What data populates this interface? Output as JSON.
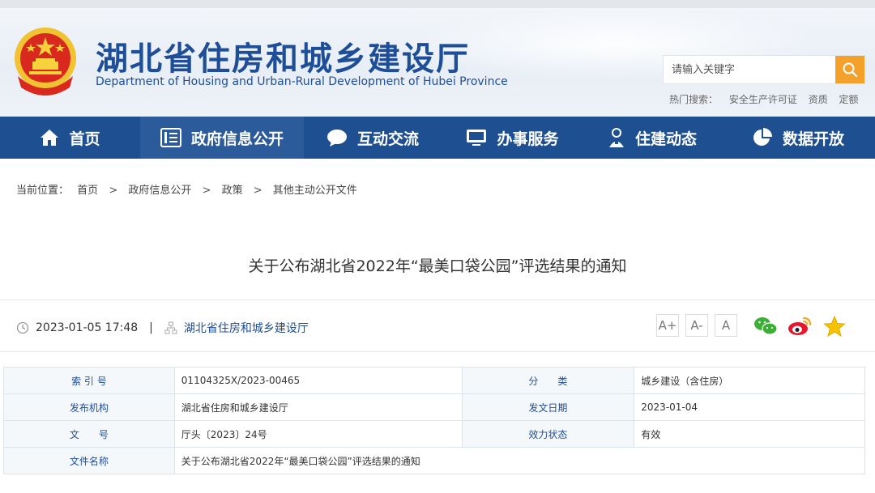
{
  "header": {
    "site_title": "湖北省住房和城乡建设厅",
    "site_subtitle": "Department of Housing and Urban-Rural Development of Hubei Province",
    "search_placeholder": "请输入关键字",
    "hot_label": "热门搜索：",
    "hot_terms": [
      "安全生产许可证",
      "资质",
      "定额"
    ]
  },
  "nav": [
    {
      "label": "首页",
      "icon": "home-icon"
    },
    {
      "label": "政府信息公开",
      "icon": "list-icon",
      "active": true
    },
    {
      "label": "互动交流",
      "icon": "chat-bubble-icon"
    },
    {
      "label": "办事服务",
      "icon": "monitor-icon"
    },
    {
      "label": "住建动态",
      "icon": "person-icon"
    },
    {
      "label": "数据开放",
      "icon": "pie-chart-icon"
    }
  ],
  "breadcrumb": {
    "prefix": "当前位置：",
    "items": [
      "首页",
      "政府信息公开",
      "政策",
      "其他主动公开文件"
    ],
    "separator": ">"
  },
  "article": {
    "title": "关于公布湖北省2022年“最美口袋公园”评选结果的通知",
    "datetime": "2023-01-05 17:48",
    "pipe": "|",
    "source": "湖北省住房和城乡建设厅"
  },
  "font_controls": [
    "A+",
    "A-",
    "A"
  ],
  "share": [
    "wechat-icon",
    "weibo-icon",
    "favorite-star-icon"
  ],
  "info_table": {
    "rows": [
      [
        "索 引 号",
        "01104325X/2023-00465",
        "分　　类",
        "城乡建设（含住房）"
      ],
      [
        "发布机构",
        "湖北省住房和城乡建设厅",
        "发文日期",
        "2023-01-04"
      ],
      [
        "文　　号",
        "厅头〔2023〕24号",
        "效力状态",
        "有效"
      ],
      [
        "文件名称",
        "关于公布湖北省2022年“最美口袋公园”评选结果的通知"
      ]
    ]
  },
  "colors": {
    "brand_blue": "#1f4e98",
    "nav_bg": "#1e4f91",
    "search_accent": "#f3a12a"
  }
}
